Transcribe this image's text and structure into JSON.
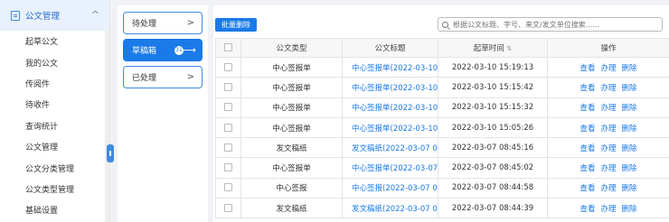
{
  "sidebar": {
    "header_title": "公文管理",
    "items": [
      "起草公文",
      "我的公文",
      "传阅件",
      "待收件",
      "查询统计",
      "公文管理",
      "公文分类管理",
      "公文类型管理",
      "基础设置"
    ]
  },
  "status": {
    "pending": "待处理",
    "draft": "草稿箱",
    "draft_count": "31",
    "processed": "已处理"
  },
  "toolbar": {
    "batch_delete": "批量删除",
    "search_placeholder": "根据公文标题、字号、来文/发文单位搜索......"
  },
  "table": {
    "headers": [
      "公文类型",
      "公文标题",
      "起草时间",
      "操作"
    ],
    "actions": [
      "查看",
      "办理",
      "删除"
    ],
    "rows": [
      {
        "type": "中心签报单",
        "title": "中心签报单(2022-03-10...",
        "time": "2022-03-10 15:19:13"
      },
      {
        "type": "中心签报单",
        "title": "中心签报单(2022-03-10...",
        "time": "2022-03-10 15:15:42"
      },
      {
        "type": "中心签报单",
        "title": "中心签报单(2022-03-10...",
        "time": "2022-03-10 15:15:32"
      },
      {
        "type": "中心签报单",
        "title": "中心签报单(2022-03-10...",
        "time": "2022-03-10 15:05:26"
      },
      {
        "type": "发文稿纸",
        "title": "发文稿纸(2022-03-07 0...",
        "time": "2022-03-07 08:45:16"
      },
      {
        "type": "中心签报单",
        "title": "中心签报单(2022-03-07...",
        "time": "2022-03-07 08:45:02"
      },
      {
        "type": "中心签报",
        "title": "中心签报(2022-03-07 0...",
        "time": "2022-03-07 08:44:58"
      },
      {
        "type": "发文稿纸",
        "title": "发文稿纸(2022-03-07 0...",
        "time": "2022-03-07 08:44:39"
      }
    ]
  },
  "colors": {
    "accent": "#1a7ae8",
    "sidebar_header_bg": "#e8f1fc"
  }
}
